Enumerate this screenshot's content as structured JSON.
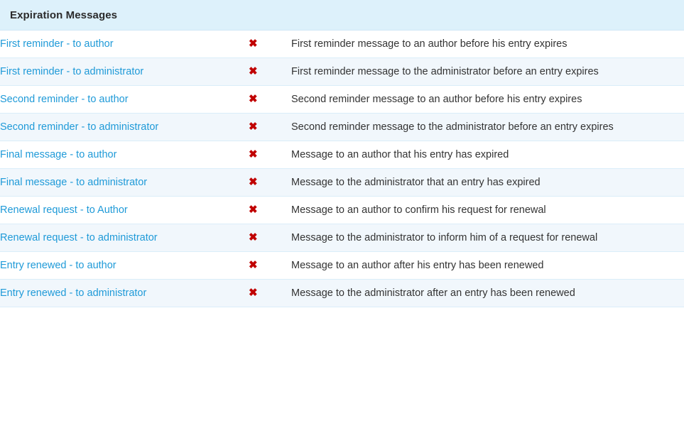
{
  "panel": {
    "header": {
      "title": "Expiration Messages"
    },
    "status_icon_glyph": "✖",
    "status_icon_name": "cross-mark-icon",
    "colors": {
      "header_background": "#ddf1fb",
      "row_background": "#ffffff",
      "row_alt_background": "#f1f7fc",
      "row_divider": "#daedf9",
      "link": "#1f9ad8",
      "description_text": "#333333",
      "header_text": "#2b2b2b",
      "status_icon": "#c00000"
    },
    "rows": [
      {
        "name": "First reminder - to author",
        "status": "✖",
        "description": "First reminder message to an author before his entry expires"
      },
      {
        "name": "First reminder - to administrator",
        "status": "✖",
        "description": "First reminder message to the administrator before an entry expires"
      },
      {
        "name": "Second reminder - to author",
        "status": "✖",
        "description": "Second reminder message to an author before his entry expires"
      },
      {
        "name": "Second reminder - to administrator",
        "status": "✖",
        "description": "Second reminder message to the administrator before an entry expires"
      },
      {
        "name": "Final message - to author",
        "status": "✖",
        "description": "Message to an author that his entry has expired"
      },
      {
        "name": "Final message - to administrator",
        "status": "✖",
        "description": "Message to the administrator that an entry has expired"
      },
      {
        "name": "Renewal request - to Author",
        "status": "✖",
        "description": "Message to an author to confirm his request for renewal"
      },
      {
        "name": "Renewal request - to administrator",
        "status": "✖",
        "description": "Message to the administrator to inform him of a request for renewal"
      },
      {
        "name": "Entry renewed - to author",
        "status": "✖",
        "description": "Message to an author after his entry has been renewed"
      },
      {
        "name": "Entry renewed - to administrator",
        "status": "✖",
        "description": "Message to the administrator after an entry has been renewed"
      }
    ]
  }
}
